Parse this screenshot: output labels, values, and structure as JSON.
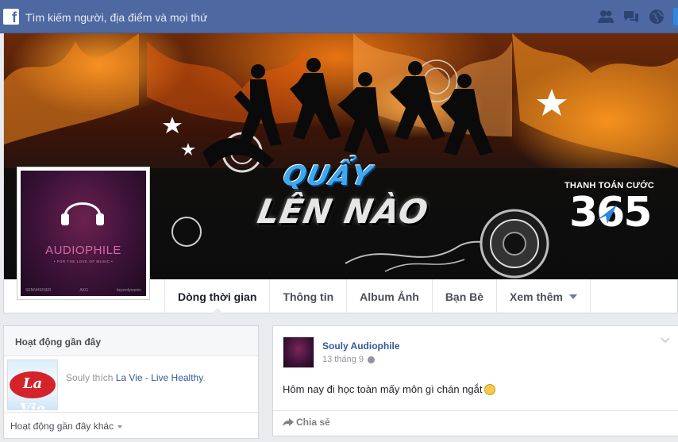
{
  "topbar": {
    "logo": "f",
    "search_placeholder": "Tìm kiếm người, địa điểm và mọi thứ",
    "icons": [
      "friend-requests-icon",
      "messages-icon",
      "notifications-globe-icon"
    ]
  },
  "cover": {
    "headline_top": "QUẨY",
    "headline_bottom": "LÊN NÀO",
    "brand_tagline": "THANH TOÁN CƯỚC",
    "brand_number": "365"
  },
  "profile_picture": {
    "title": "AUDIOPHILE",
    "subtitle": "• FOR THE LOVE OF MUSIC •",
    "footer_left": "SENNHEISER",
    "footer_mid": "AKG",
    "footer_right": "beyerdynamic"
  },
  "tabs": [
    {
      "label": "Dòng thời gian"
    },
    {
      "label": "Thông tin"
    },
    {
      "label": "Album Ảnh"
    },
    {
      "label": "Bạn Bè"
    },
    {
      "label": "Xem thêm"
    }
  ],
  "recent_activity": {
    "header": "Hoạt động gần đây",
    "item": {
      "thumb_text": "La Vie",
      "actor_text": "Souly thích ",
      "link": "La Vie - Live Healthy",
      "suffix": "."
    },
    "more": "Hoạt động gần đây khác"
  },
  "post": {
    "author": "Souly Audiophile",
    "date": "13 tháng 9",
    "text": "Hôm nay đi học toàn mấy môn gì chán ngắt",
    "share": "Chia sẻ"
  },
  "colors": {
    "topbar": "#4e69a2",
    "link": "#365899",
    "page_bg": "#e9ebee"
  }
}
